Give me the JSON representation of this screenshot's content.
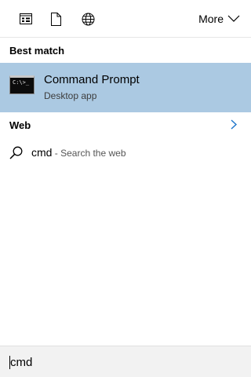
{
  "toolbar": {
    "icons": [
      "apps-filter-icon",
      "documents-filter-icon",
      "web-filter-icon"
    ],
    "more_label": "More"
  },
  "best_match": {
    "heading": "Best match",
    "item": {
      "icon": "command-prompt-icon",
      "icon_text": "C:\\>_",
      "title": "Command Prompt",
      "subtitle": "Desktop app"
    }
  },
  "web": {
    "heading": "Web",
    "suggestion": {
      "query": "cmd",
      "suffix": " - Search the web"
    }
  },
  "search_box": {
    "value": "cmd"
  },
  "colors": {
    "selected_row": "#abc9e2",
    "accent": "#1a73c9"
  }
}
